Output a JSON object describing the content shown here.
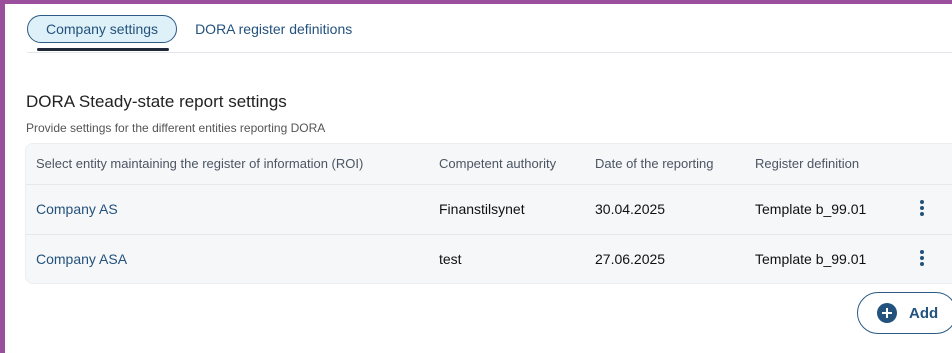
{
  "tabs": [
    {
      "label": "Company settings",
      "active": true
    },
    {
      "label": "DORA register definitions",
      "active": false
    }
  ],
  "section": {
    "title": "DORA Steady-state report settings",
    "subtitle": "Provide settings for the different entities reporting DORA"
  },
  "table": {
    "headers": [
      "Select entity maintaining the register of information (ROI)",
      "Competent authority",
      "Date of the reporting",
      "Register definition"
    ],
    "rows": [
      {
        "entity": "Company AS",
        "authority": "Finanstilsynet",
        "date": "30.04.2025",
        "definition": "Template b_99.01",
        "menu_icon": "kebab-menu-icon"
      },
      {
        "entity": "Company ASA",
        "authority": "test",
        "date": "27.06.2025",
        "definition": "Template b_99.01",
        "menu_icon": "kebab-menu-icon"
      }
    ]
  },
  "actions": {
    "add_label": "Add",
    "add_icon": "plus-circle-icon"
  },
  "colors": {
    "accent": "#23527d",
    "frame": "#9a4f9c",
    "tab_active_bg": "#dff1f8"
  }
}
